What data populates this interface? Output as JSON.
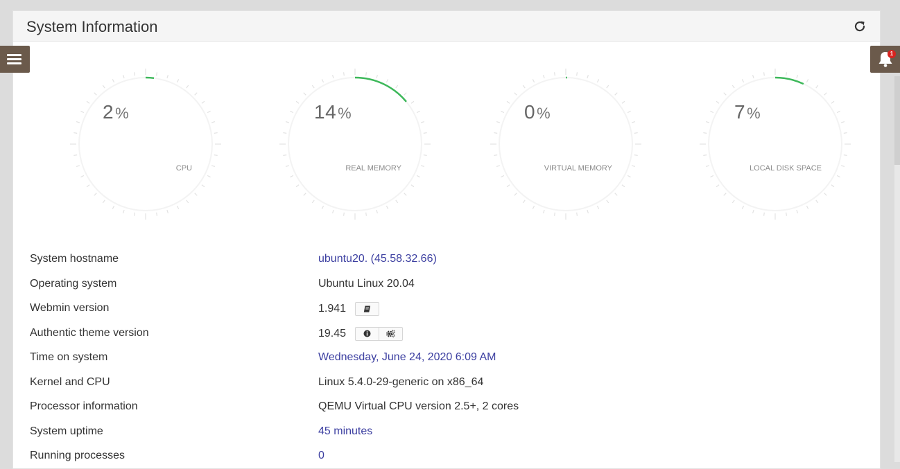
{
  "panel": {
    "title": "System Information"
  },
  "notifications": {
    "count": "1"
  },
  "gauges": [
    {
      "value": "2",
      "unit": "%",
      "label": "CPU"
    },
    {
      "value": "14",
      "unit": "%",
      "label": "REAL MEMORY"
    },
    {
      "value": "0",
      "unit": "%",
      "label": "VIRTUAL MEMORY"
    },
    {
      "value": "7",
      "unit": "%",
      "label": "LOCAL DISK SPACE"
    }
  ],
  "info": [
    {
      "label": "System hostname",
      "value": "ubuntu20. (45.58.32.66)"
    },
    {
      "label": "Operating system",
      "value": "Ubuntu Linux 20.04"
    },
    {
      "label": "Webmin version",
      "value": "1.941"
    },
    {
      "label": "Authentic theme version",
      "value": "19.45"
    },
    {
      "label": "Time on system",
      "value": "Wednesday, June 24, 2020 6:09 AM"
    },
    {
      "label": "Kernel and CPU",
      "value": "Linux 5.4.0-29-generic on x86_64"
    },
    {
      "label": "Processor information",
      "value": "QEMU Virtual CPU version 2.5+, 2 cores"
    },
    {
      "label": "System uptime",
      "value": "45 minutes"
    },
    {
      "label": "Running processes",
      "value": "0"
    }
  ],
  "colors": {
    "accent": "#3db85a",
    "link": "#3b3ea0",
    "brand": "#6b5a4b",
    "badge": "#d9231f"
  }
}
